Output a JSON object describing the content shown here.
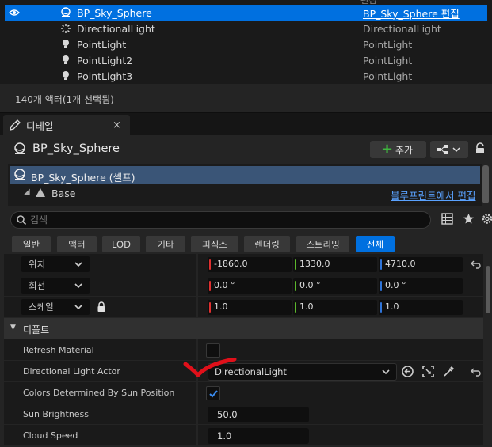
{
  "outliner": {
    "partial_top_text": "편집",
    "rows": [
      {
        "name": "BP_Sky_Sphere",
        "type": "BP_Sky_Sphere 편집",
        "selected": true,
        "icon": "sphere-actor-icon"
      },
      {
        "name": "DirectionalLight",
        "type": "DirectionalLight",
        "selected": false,
        "icon": "directional-light-icon"
      },
      {
        "name": "PointLight",
        "type": "PointLight",
        "selected": false,
        "icon": "bulb-icon"
      },
      {
        "name": "PointLight2",
        "type": "PointLight",
        "selected": false,
        "icon": "bulb-icon"
      },
      {
        "name": "PointLight3",
        "type": "PointLight",
        "selected": false,
        "icon": "bulb-icon"
      }
    ],
    "actor_count": "140개 액터(1개 선택됨)"
  },
  "details": {
    "tab_label": "디테일",
    "tab_close": "×",
    "actor_name": "BP_Sky_Sphere",
    "add_button": "추가",
    "component_self": "BP_Sky_Sphere (셀프)",
    "component_base": "Base",
    "edit_blueprint_link": "블루프린트에서 편집",
    "search": {
      "placeholder": "검색",
      "value": ""
    },
    "filters": [
      "일반",
      "액터",
      "LOD",
      "기타",
      "피직스",
      "렌더링",
      "스트리밍",
      "전체"
    ],
    "active_filter": "전체",
    "transform": {
      "location": {
        "label": "위치",
        "x": "-1860.0",
        "y": "1330.0",
        "z": "4710.0"
      },
      "rotation": {
        "label": "회전",
        "x": "0.0 °",
        "y": "0.0 °",
        "z": "0.0 °"
      },
      "scale": {
        "label": "스케일",
        "x": "1.0",
        "y": "1.0",
        "z": "1.0"
      }
    },
    "category_default": "디폴트",
    "properties": {
      "refresh_material": {
        "label": "Refresh Material",
        "checked": false
      },
      "directional_light_actor": {
        "label": "Directional Light Actor",
        "value": "DirectionalLight"
      },
      "colors_by_sun": {
        "label": "Colors Determined By Sun Position",
        "checked": true
      },
      "sun_brightness": {
        "label": "Sun Brightness",
        "value": "50.0"
      },
      "cloud_speed": {
        "label": "Cloud Speed",
        "value": "1.0"
      }
    }
  },
  "colors": {
    "selection_blue": "#0070e0",
    "axis_x": "#e03030",
    "axis_y": "#5cb82c",
    "axis_z": "#2f74d8",
    "annotation_red": "#e0101a",
    "link_blue": "#5aa2ff"
  }
}
